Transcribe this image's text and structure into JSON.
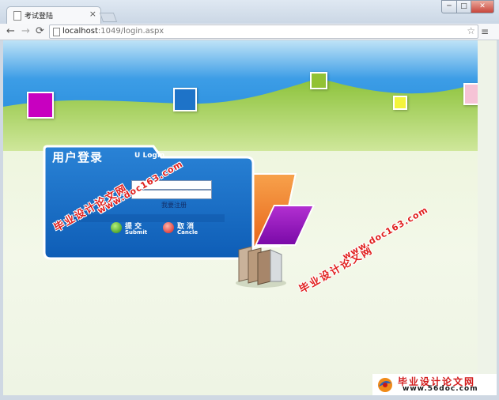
{
  "browser": {
    "tab_title": "考试登陆",
    "tab_close": "×",
    "url_host": "localhost",
    "url_path": ":1049/login.aspx",
    "window_controls": {
      "minimize": "─",
      "maximize": "□",
      "close": "✕"
    },
    "nav": {
      "back": "←",
      "forward": "→",
      "reload": "⟳",
      "star": "☆",
      "menu": "≡"
    }
  },
  "login": {
    "title_cn": "用户登录",
    "title_en": "U",
    "title_en_suffix": "Login",
    "username_label": "",
    "password_label": "码:",
    "username_value": "",
    "password_value": "",
    "register_link": "我要注册",
    "submit": {
      "cn": "提 交",
      "en": "Submit"
    },
    "cancel": {
      "cn": "取 消",
      "en": "Cancle"
    }
  },
  "watermarks": {
    "cn": "毕业设计论文网",
    "url": "www.doc163.com"
  },
  "footer_logo": {
    "cn": "毕业设计论文网",
    "url": "www.56doc.com"
  },
  "colors": {
    "sky": "#2a8fe3",
    "grass": "#9fcb3d",
    "panel": "#1d6fc6",
    "watermark": "#e0201e"
  }
}
